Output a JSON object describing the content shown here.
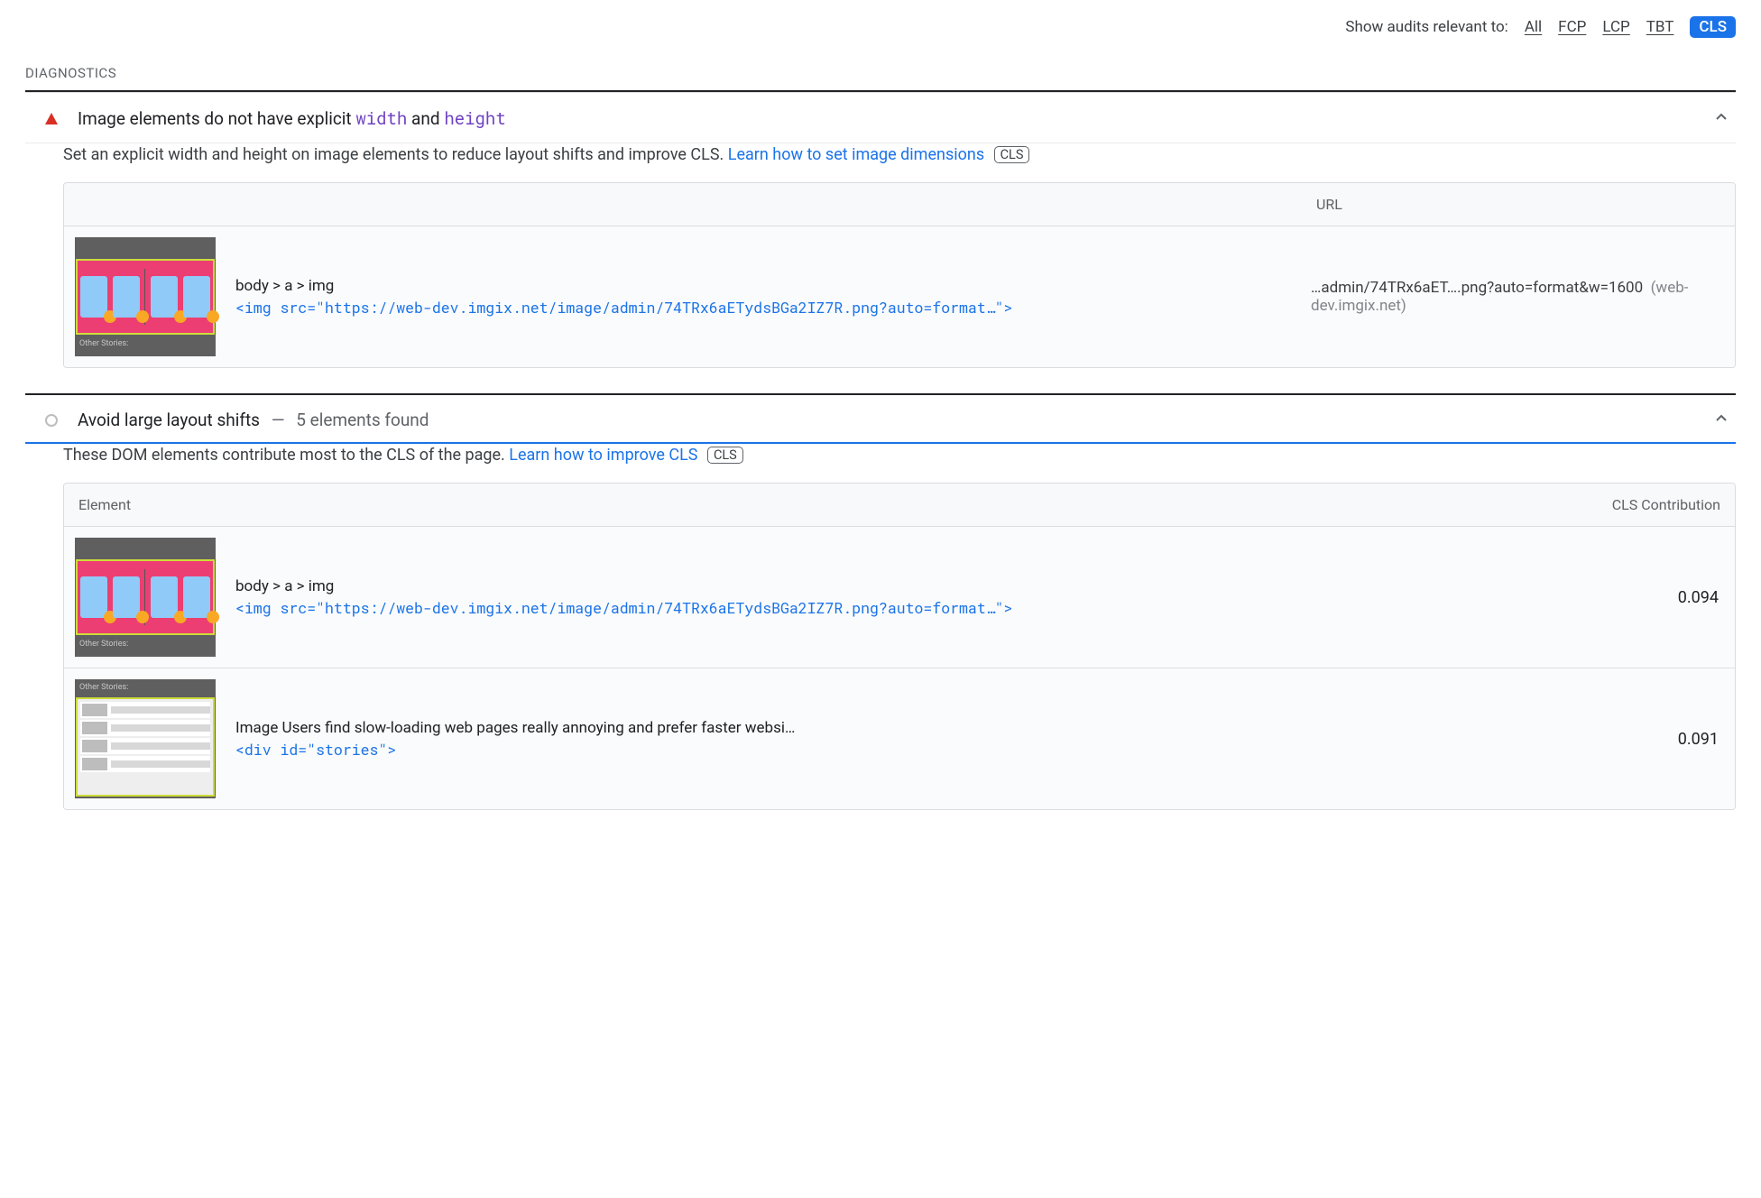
{
  "filter": {
    "label": "Show audits relevant to:",
    "links": [
      "All",
      "FCP",
      "LCP",
      "TBT"
    ],
    "active": "CLS"
  },
  "section_title": "DIAGNOSTICS",
  "audits": [
    {
      "title_pre": "Image elements do not have explicit ",
      "title_param1": "width",
      "title_mid": " and ",
      "title_param2": "height",
      "desc_pre": "Set an explicit width and height on image elements to reduce layout shifts and improve CLS. ",
      "learn": "Learn how to set image dimensions",
      "badge": "CLS",
      "head_url": "URL",
      "row": {
        "selector": "body > a > img",
        "code": "<img src=\"https://web-dev.imgix.net/image/admin/74TRx6aETydsBGa2IZ7R.png?auto=format…\">",
        "url_text": "…admin/74TRx6aET….png?auto=format&w=1600",
        "url_host": "(web-dev.imgix.net)",
        "thumb_label": "Other Stories:"
      }
    },
    {
      "title": "Avoid large layout shifts",
      "sub": "5 elements found",
      "desc_pre": "These DOM elements contribute most to the CLS of the page. ",
      "learn": "Learn how to improve CLS",
      "badge": "CLS",
      "head_left": "Element",
      "head_right": "CLS Contribution",
      "rows": [
        {
          "selector": "body > a > img",
          "code": "<img src=\"https://web-dev.imgix.net/image/admin/74TRx6aETydsBGa2IZ7R.png?auto=format…\">",
          "val": "0.094",
          "thumb_label": "Other Stories:"
        },
        {
          "title": "Image Users find slow-loading web pages really annoying and prefer faster websi…",
          "code": "<div id=\"stories\">",
          "val": "0.091",
          "thumb_label": "Other Stories:"
        }
      ]
    }
  ]
}
